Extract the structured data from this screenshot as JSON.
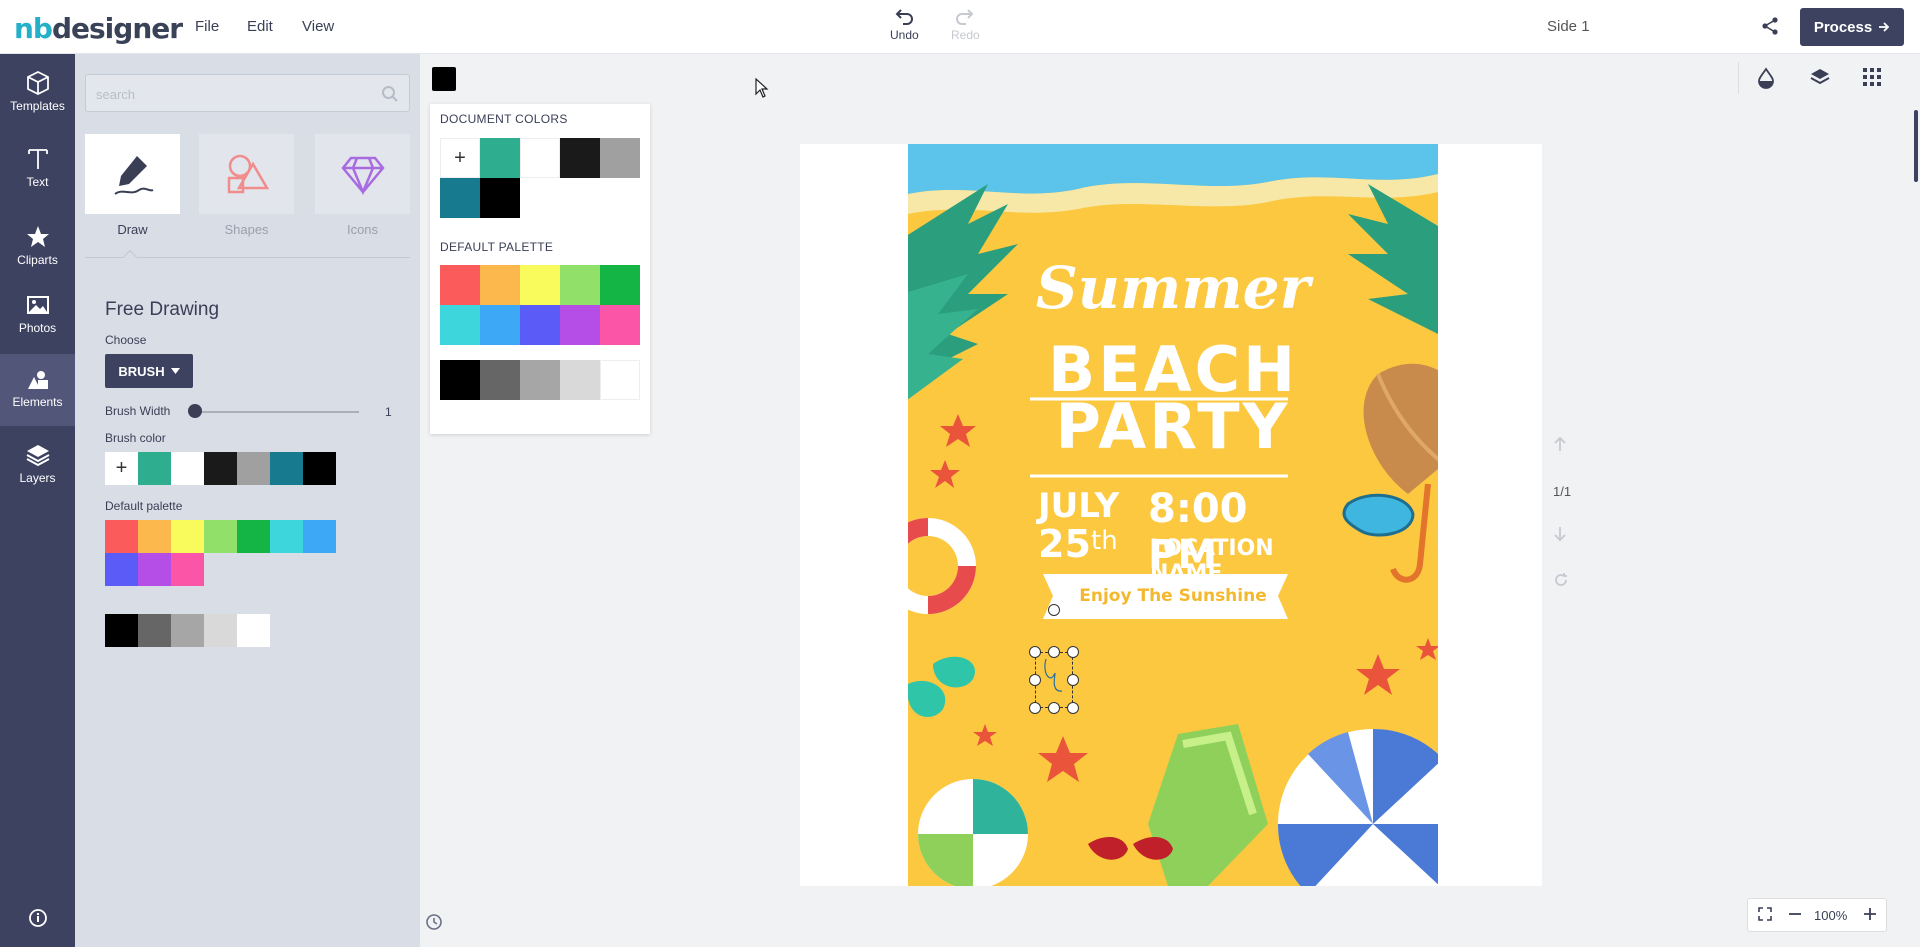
{
  "app": {
    "logo_prefix": "nb",
    "logo_suffix": "designer"
  },
  "menu": {
    "file": "File",
    "edit": "Edit",
    "view": "View"
  },
  "history": {
    "undo": "Undo",
    "redo": "Redo"
  },
  "side_label": "Side 1",
  "process_label": "Process",
  "leftbar": {
    "templates": "Templates",
    "text": "Text",
    "cliparts": "Cliparts",
    "photos": "Photos",
    "elements": "Elements",
    "layers": "Layers"
  },
  "panel": {
    "search_placeholder": "search",
    "tiles": {
      "draw": "Draw",
      "shapes": "Shapes",
      "icons": "Icons"
    },
    "heading": "Free Drawing",
    "choose_label": "Choose",
    "brush_button": "BRUSH",
    "brush_width_label": "Brush Width",
    "brush_width_value": "1",
    "brush_color_label": "Brush color",
    "default_palette_label": "Default palette"
  },
  "colors": {
    "document": [
      "#2fae8f",
      "#ffffff",
      "#1a1a1a",
      "#a0a0a0",
      "#187a8e",
      "#000000"
    ],
    "palette_row1": [
      "#fb5b5b",
      "#fdb84d",
      "#f9fa5b",
      "#90e06a",
      "#14b545",
      "#3dd6dc",
      "#3ca8f6"
    ],
    "palette_row2": [
      "#5b5cf7",
      "#b54ee6",
      "#fb55a8"
    ],
    "grays": [
      "#000000",
      "#666666",
      "#a6a6a6",
      "#d9d9d9",
      "#ffffff"
    ],
    "popup_palette": [
      "#fb5b5b",
      "#fdb84d",
      "#f9fa5b",
      "#90e06a",
      "#14b545",
      "#3dd6dc",
      "#3ca8f6",
      "#5b5cf7",
      "#b54ee6",
      "#fb55a8"
    ]
  },
  "popup": {
    "document_colors": "DOCUMENT COLORS",
    "default_palette": "DEFAULT PALETTE"
  },
  "poster": {
    "line1": "Summer",
    "line2": "BEACH",
    "line3": "PARTY",
    "month": "JULY",
    "day": "25",
    "day_suffix": "th",
    "time": "8:00 PM",
    "location": "LOCATION NAME",
    "banner": "Enjoy The Sunshine"
  },
  "pagenav": {
    "page": "1/1"
  },
  "zoom": {
    "value": "100%"
  }
}
